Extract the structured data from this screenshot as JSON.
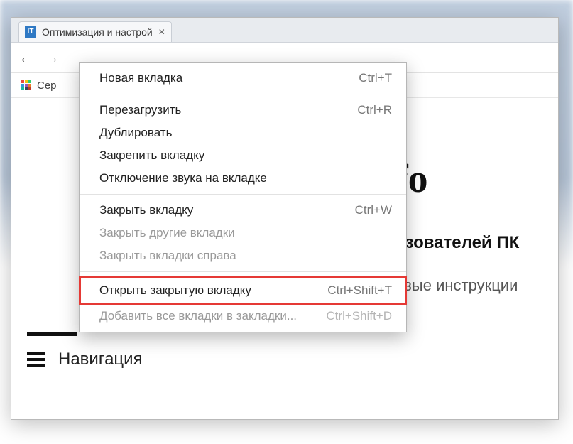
{
  "tab": {
    "favicon_text": "IT",
    "title": "Оптимизация и настрой"
  },
  "bookmarks_bar": {
    "apps_label": "Сер"
  },
  "page": {
    "logo_fragment": "fo",
    "subtitle1": "ьзователей ПК",
    "subtitle2": "овые инструкции",
    "nav_label": "Навигация"
  },
  "context_menu": {
    "items": [
      {
        "label": "Новая вкладка",
        "shortcut": "Ctrl+T",
        "disabled": false
      },
      {
        "sep": true
      },
      {
        "label": "Перезагрузить",
        "shortcut": "Ctrl+R",
        "disabled": false
      },
      {
        "label": "Дублировать",
        "shortcut": "",
        "disabled": false
      },
      {
        "label": "Закрепить вкладку",
        "shortcut": "",
        "disabled": false
      },
      {
        "label": "Отключение звука на вкладке",
        "shortcut": "",
        "disabled": false
      },
      {
        "sep": true
      },
      {
        "label": "Закрыть вкладку",
        "shortcut": "Ctrl+W",
        "disabled": false
      },
      {
        "label": "Закрыть другие вкладки",
        "shortcut": "",
        "disabled": true
      },
      {
        "label": "Закрыть вкладки справа",
        "shortcut": "",
        "disabled": true
      },
      {
        "sep": true
      },
      {
        "label": "Открыть закрытую вкладку",
        "shortcut": "Ctrl+Shift+T",
        "disabled": false,
        "highlighted": true
      },
      {
        "label": "Добавить все вкладки в закладки...",
        "shortcut": "Ctrl+Shift+D",
        "disabled": true
      }
    ]
  }
}
